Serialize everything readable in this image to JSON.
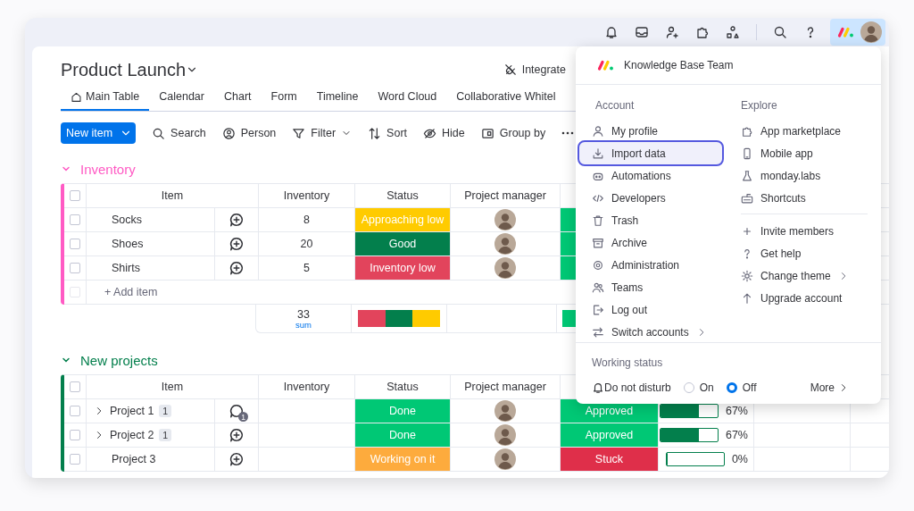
{
  "board": {
    "title": "Product Launch",
    "integrate": "Integrate"
  },
  "tabs": [
    {
      "label": "Main Table",
      "selected": true
    },
    {
      "label": "Calendar",
      "selected": false
    },
    {
      "label": "Chart",
      "selected": false
    },
    {
      "label": "Form",
      "selected": false
    },
    {
      "label": "Timeline",
      "selected": false
    },
    {
      "label": "Word Cloud",
      "selected": false
    },
    {
      "label": "Collaborative Whitel",
      "selected": false
    }
  ],
  "toolbar": {
    "new_item": "New item",
    "actions": [
      {
        "label": "Search",
        "dropdown": false
      },
      {
        "label": "Person",
        "dropdown": false
      },
      {
        "label": "Filter",
        "dropdown": true
      },
      {
        "label": "Sort",
        "dropdown": false
      },
      {
        "label": "Hide",
        "dropdown": false
      },
      {
        "label": "Group by",
        "dropdown": false
      }
    ]
  },
  "groups": [
    {
      "title": "Inventory",
      "color": "#ff5ac4",
      "header_checked": false,
      "columns": [
        "Item",
        "Inventory",
        "Status",
        "Project manager"
      ],
      "rows": [
        {
          "item": "Socks",
          "checked": false,
          "inventory": "8",
          "status": {
            "label": "Approaching low",
            "color": "#ffcb00"
          },
          "column_7": {
            "color": "#00c875"
          }
        },
        {
          "item": "Shoes",
          "checked": false,
          "inventory": "20",
          "status": {
            "label": "Good",
            "color": "#037f4c"
          },
          "column_7": {
            "color": "#00c875"
          }
        },
        {
          "item": "Shirts",
          "checked": false,
          "inventory": "5",
          "status": {
            "label": "Inventory low",
            "color": "#e2445c"
          },
          "column_7": {
            "color": "#00c875"
          }
        }
      ],
      "add_item": {
        "label": "+ Add item",
        "checked": false
      },
      "summary": {
        "inventory": "33",
        "note": "sum",
        "status_segments": [
          {
            "color": "#e2445c"
          },
          {
            "color": "#037f4c"
          },
          {
            "color": "#ffcb00"
          }
        ],
        "column_7": {
          "color": "#00c875"
        }
      }
    },
    {
      "title": "New projects",
      "color": "#037f4c",
      "header_checked": false,
      "columns": [
        "Item",
        "Inventory",
        "Status",
        "Project manager"
      ],
      "rows": [
        {
          "item": "Project 1",
          "checked": false,
          "subitems": "1",
          "updates": "1",
          "status": {
            "label": "Done",
            "color": "#00c875"
          },
          "column_7": {
            "label": "Approved",
            "color": "#00c875"
          },
          "progress": {
            "level": 0.67,
            "reading": "67%"
          }
        },
        {
          "item": "Project 2",
          "checked": false,
          "subitems": "1",
          "status": {
            "label": "Done",
            "color": "#00c875"
          },
          "column_7": {
            "label": "Approved",
            "color": "#00c875"
          },
          "progress": {
            "level": 0.67,
            "reading": "67%"
          }
        },
        {
          "item": "Project 3",
          "checked": false,
          "status": {
            "label": "Working on it",
            "color": "#fdab3d"
          },
          "column_7": {
            "label": "Stuck",
            "color": "#df2f4a"
          },
          "progress": {
            "level": 0,
            "reading": "0%"
          }
        }
      ]
    }
  ],
  "menu": {
    "team": "Knowledge Base Team",
    "account": {
      "title": "Account",
      "items": [
        {
          "label": "My profile",
          "highlighted": false,
          "submenu": false
        },
        {
          "label": "Import data",
          "highlighted": true,
          "submenu": false
        },
        {
          "label": "Automations",
          "highlighted": false,
          "submenu": false
        },
        {
          "label": "Developers",
          "highlighted": false,
          "submenu": false
        },
        {
          "label": "Trash",
          "highlighted": false,
          "submenu": false
        },
        {
          "label": "Archive",
          "highlighted": false,
          "submenu": false
        },
        {
          "label": "Administration",
          "highlighted": false,
          "submenu": false
        },
        {
          "label": "Teams",
          "highlighted": false,
          "submenu": false
        },
        {
          "label": "Log out",
          "highlighted": false,
          "submenu": false
        },
        {
          "label": "Switch accounts",
          "highlighted": false,
          "submenu": true
        }
      ]
    },
    "explore": {
      "title": "Explore",
      "items": [
        {
          "label": "App marketplace",
          "highlighted": false,
          "submenu": false
        },
        {
          "label": "Mobile app",
          "highlighted": false,
          "submenu": false
        },
        {
          "label": "monday.labs",
          "highlighted": false,
          "submenu": false
        },
        {
          "label": "Shortcuts",
          "highlighted": false,
          "submenu": false
        }
      ],
      "more_items": [
        {
          "label": "Invite members",
          "highlighted": false,
          "submenu": false
        },
        {
          "label": "Get help",
          "highlighted": false,
          "submenu": false
        },
        {
          "label": "Change theme",
          "highlighted": false,
          "submenu": true
        },
        {
          "label": "Upgrade account",
          "highlighted": false,
          "submenu": false
        }
      ]
    },
    "working_status": {
      "title": "Working status",
      "label": "Do not disturb",
      "options": [
        {
          "label": "On",
          "selected": false
        },
        {
          "label": "Off",
          "selected": true
        }
      ],
      "more": "More"
    }
  }
}
